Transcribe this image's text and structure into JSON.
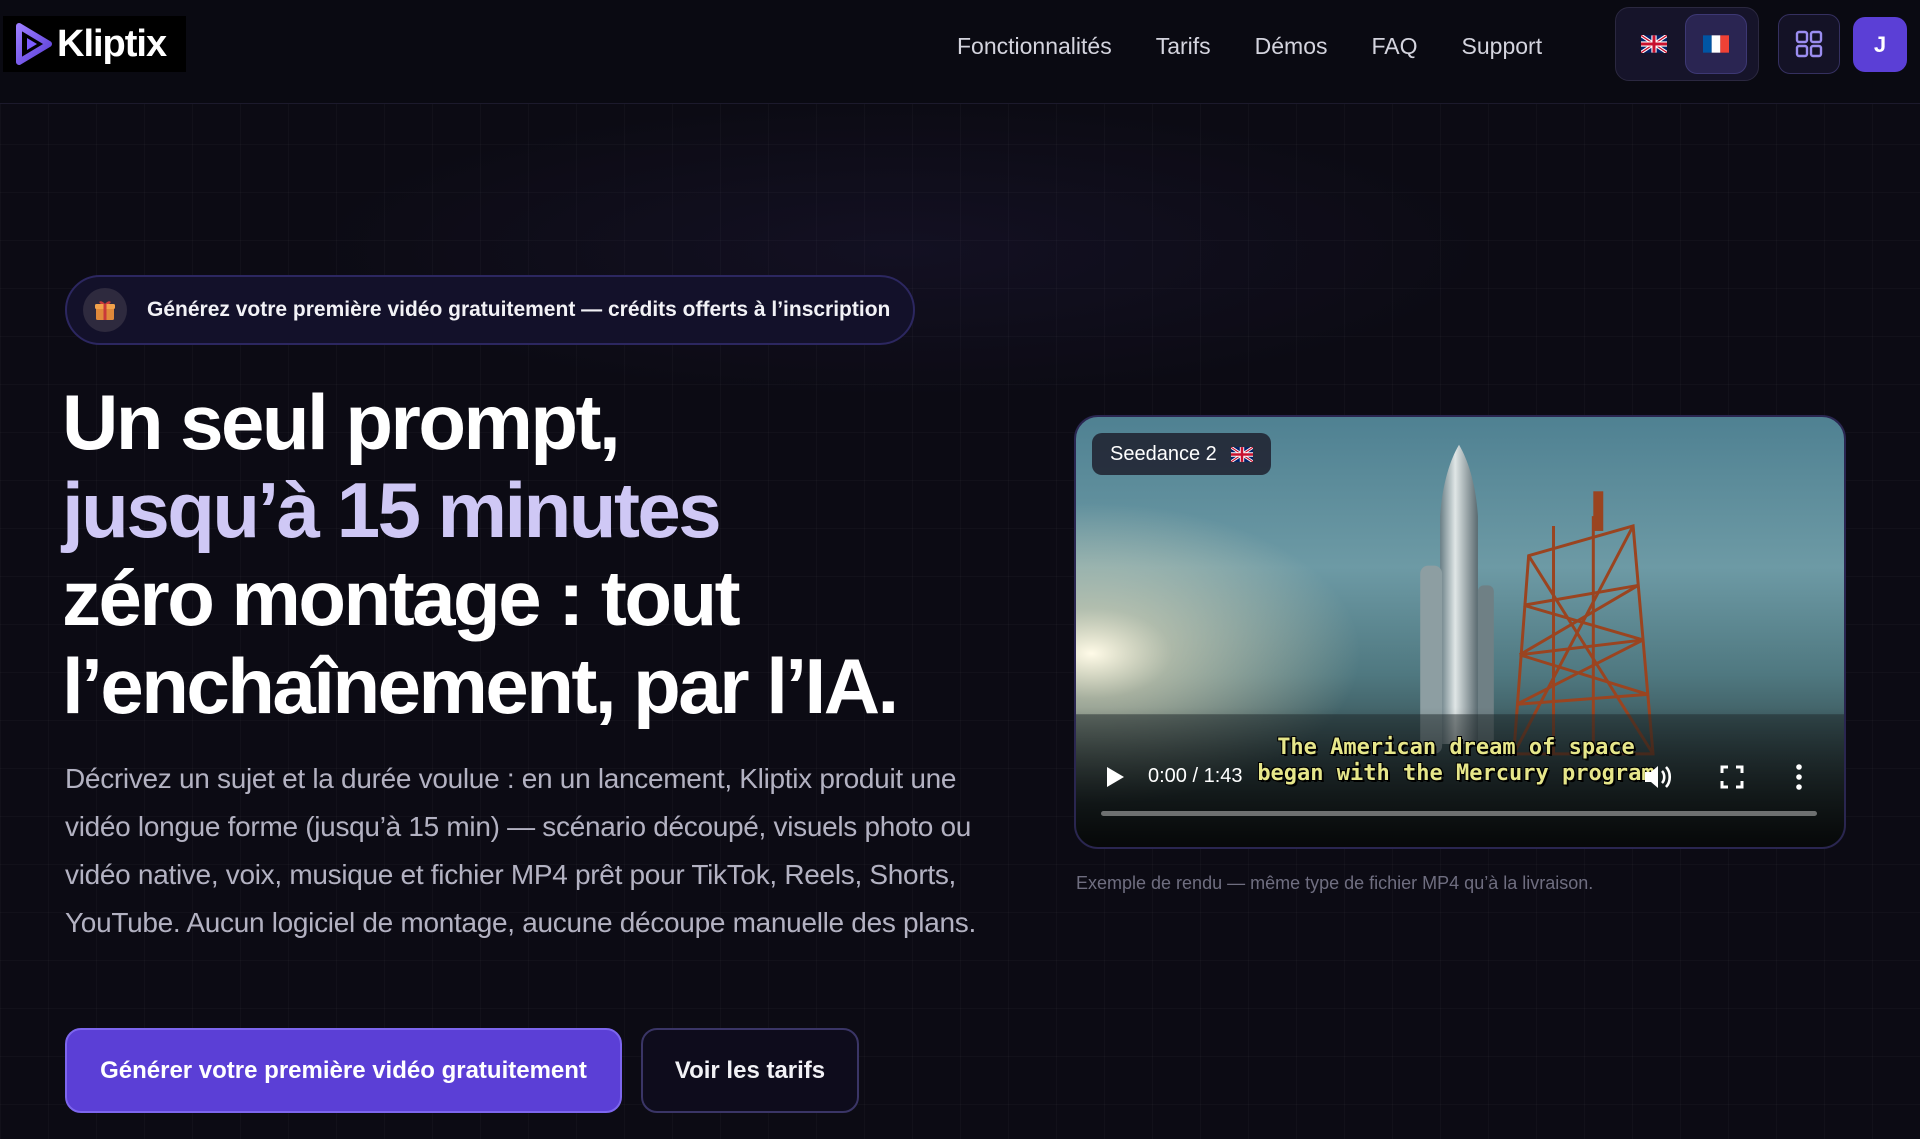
{
  "brand": {
    "name": "Kliptix",
    "accent": "#5b3fd6"
  },
  "nav": {
    "links": [
      "Fonctionnalités",
      "Tarifs",
      "Démos",
      "FAQ",
      "Support"
    ],
    "languages": [
      {
        "code": "en",
        "icon": "uk-flag-icon",
        "active": false
      },
      {
        "code": "fr",
        "icon": "france-flag-icon",
        "active": true
      }
    ],
    "apps_icon": "grid-icon",
    "avatar_initial": "J"
  },
  "hero": {
    "promo": {
      "icon": "gift-icon",
      "text": "Générez votre première vidéo gratuitement — crédits offerts à l’inscription"
    },
    "headline": [
      {
        "text": "Un seul prompt,",
        "style": "white"
      },
      {
        "text": "jusqu’à 15 minutes",
        "style": "purple"
      },
      {
        "text": "zéro montage : tout",
        "style": "white"
      },
      {
        "text": "l’enchaînement, par l’IA.",
        "style": "white"
      }
    ],
    "description": "Décrivez un sujet et la durée voulue : en un lancement, Kliptix produit une vidéo longue forme (jusqu’à 15 min) — scénario découpé, visuels photo ou vidéo native, voix, musique et fichier MP4 prêt pour TikTok, Reels, Shorts, YouTube. Aucun logiciel de montage, aucune découpe manuelle des plans.",
    "cta_primary": "Générer votre première vidéo gratuitement",
    "cta_secondary": "Voir les tarifs"
  },
  "video": {
    "badge": "Seedance 2",
    "badge_icon": "uk-flag-icon",
    "subtitle_line1": "The American dream of space",
    "subtitle_line2": "began with the Mercury program",
    "time": "0:00 / 1:43",
    "progress": 0,
    "caption": "Exemple de rendu — même type de fichier MP4 qu’à la livraison."
  }
}
